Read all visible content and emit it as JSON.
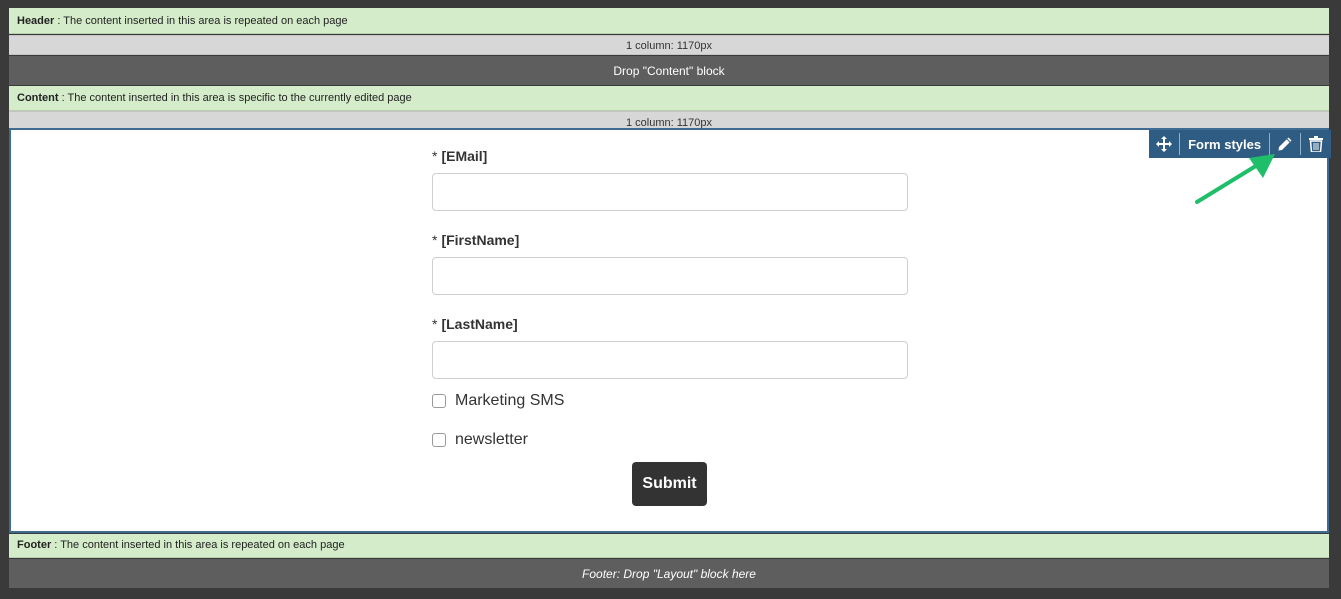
{
  "header": {
    "label_title": "Header",
    "label_text": " : The content inserted in this area is repeated on each page",
    "columns": "1 column: 1170px"
  },
  "drop_content": "Drop \"Content\" block",
  "content": {
    "label_title": "Content",
    "label_text": " : The content inserted in this area is specific to the currently edited page",
    "columns": "1 column: 1170px"
  },
  "toolbar": {
    "move_icon": "move-icon",
    "label": "Form styles",
    "edit_icon": "pencil-icon",
    "delete_icon": "trash-icon",
    "accent": "#2f5c83"
  },
  "form": {
    "fields": [
      {
        "required": "*",
        "label": "[EMail]",
        "value": "",
        "placeholder": ""
      },
      {
        "required": "*",
        "label": "[FirstName]",
        "value": "",
        "placeholder": ""
      },
      {
        "required": "*",
        "label": "[LastName]",
        "value": "",
        "placeholder": ""
      }
    ],
    "checkboxes": [
      {
        "label": "Marketing SMS",
        "checked": false
      },
      {
        "label": "newsletter",
        "checked": false
      }
    ],
    "submit": "Submit"
  },
  "footer": {
    "label_title": "Footer",
    "label_text": " : The content inserted in this area is repeated on each page",
    "drop": "Footer: Drop \"Layout\" block here"
  },
  "annotation": {
    "arrow_color": "#1fbf6a"
  }
}
